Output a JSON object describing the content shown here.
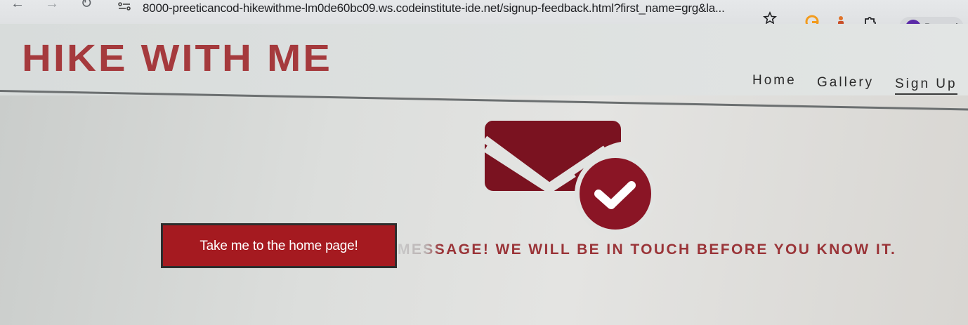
{
  "browser": {
    "url": "8000-preeticancod-hikewithme-lm0de60bc09.ws.codeinstitute-ide.net/signup-feedback.html?first_name=grg&la...",
    "profile_initial": "P",
    "profile_status": "Paused",
    "icons": [
      "back-arrow-icon",
      "forward-arrow-icon",
      "reload-icon",
      "site-info-icon",
      "bookmark-star-icon",
      "grammarly-extension-icon",
      "extension-icon",
      "puzzle-extensions-icon"
    ]
  },
  "header": {
    "logo": "HIKE WITH ME",
    "nav": {
      "home": "Home",
      "gallery": "Gallery",
      "signup": "Sign Up"
    }
  },
  "main": {
    "icon": "envelope-check-icon",
    "button_label": "Take me to the home page!",
    "message": "MESSAGE! WE WILL BE IN TOUCH BEFORE YOU KNOW IT."
  },
  "colors": {
    "brand_red": "#a53a3d",
    "button_red": "#a51a20",
    "icon_red": "#7a1220"
  }
}
